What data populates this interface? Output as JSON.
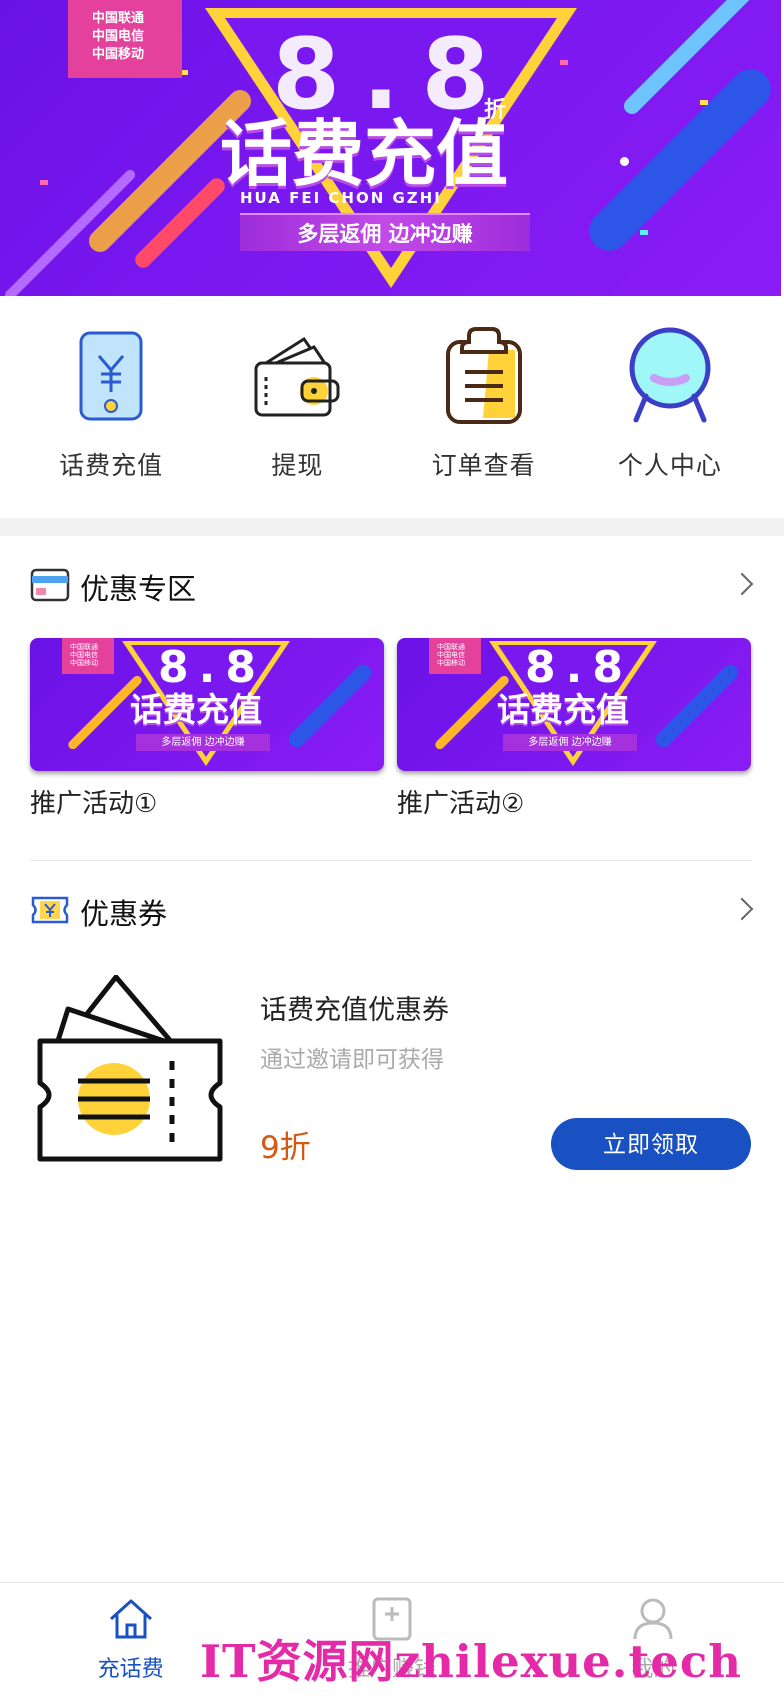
{
  "banner": {
    "carriers": [
      "中国联通",
      "中国电信",
      "中国移动"
    ],
    "headline_number": "8.8",
    "discount_suffix": "折",
    "title": "话费充值",
    "pinyin": "HUA   FEI   CHON   GZHI",
    "ribbon": "多层返佣 边冲边赚",
    "colors": {
      "background": "#7a18f0",
      "triangle": "#ffd23a",
      "carrier_tag": "#e3419c"
    }
  },
  "quick_nav": [
    {
      "label": "话费充值",
      "icon": "phone-yuan-icon"
    },
    {
      "label": "提现",
      "icon": "wallet-icon"
    },
    {
      "label": "订单查看",
      "icon": "clipboard-icon"
    },
    {
      "label": "个人中心",
      "icon": "person-icon"
    }
  ],
  "promo_section": {
    "title": "优惠专区",
    "icon": "card-icon",
    "items": [
      {
        "caption": "推广活动①",
        "banner_title": "话费充值",
        "banner_ribbon": "多层返佣 边冲边赚"
      },
      {
        "caption": "推广活动②",
        "banner_title": "话费充值",
        "banner_ribbon": "多层返佣 边冲边赚"
      }
    ]
  },
  "coupon_section": {
    "title": "优惠券",
    "icon": "ticket-yuan-icon",
    "coupon": {
      "name": "话费充值优惠券",
      "description": "通过邀请即可获得",
      "discount": "9折",
      "button": "立即领取"
    }
  },
  "tabbar": [
    {
      "label": "充话费",
      "icon": "home-icon",
      "active": true
    },
    {
      "label": "推广赚钱",
      "icon": "add-square-icon",
      "active": false
    },
    {
      "label": "我的",
      "icon": "user-icon",
      "active": false
    }
  ],
  "watermark": "IT资源网zhilexue.tech",
  "colors": {
    "accent": "#1a51c2",
    "discount": "#d35a12",
    "watermark": "#e52aa8"
  }
}
